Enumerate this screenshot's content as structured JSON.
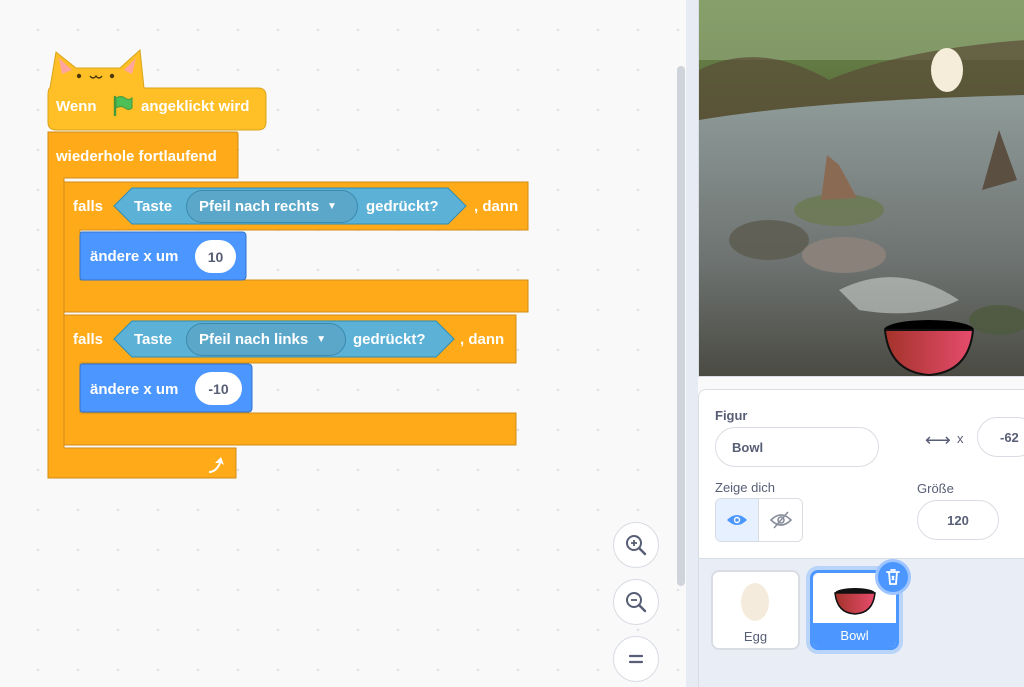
{
  "script": {
    "hat": {
      "prefix": "Wenn",
      "suffix": "angeklickt wird"
    },
    "forever_label": "wiederhole fortlaufend",
    "if1": {
      "falls": "falls",
      "taste": "Taste",
      "key": "Pfeil nach rechts",
      "pressed": "gedrückt?",
      "dann": ", dann",
      "action": "ändere x um",
      "value": "10"
    },
    "if2": {
      "falls": "falls",
      "taste": "Taste",
      "key": "Pfeil nach links",
      "pressed": "gedrückt?",
      "dann": ", dann",
      "action": "ändere x um",
      "value": "-10"
    }
  },
  "zoom": {
    "in_icon": "zoom-in-icon",
    "out_icon": "zoom-out-icon",
    "reset_icon": "zoom-reset-icon"
  },
  "sprite_info": {
    "figur_label": "Figur",
    "sprite_name": "Bowl",
    "x_label": "x",
    "x_value": "-62",
    "show_label": "Zeige dich",
    "size_label": "Größe",
    "size_value": "120"
  },
  "sprites": [
    {
      "name": "Egg",
      "selected": false
    },
    {
      "name": "Bowl",
      "selected": true
    }
  ],
  "colors": {
    "events": "#ffbf00",
    "control": "#ffab19",
    "sensing": "#5cb1d6",
    "motion": "#4c97ff",
    "accent": "#855cd6"
  }
}
